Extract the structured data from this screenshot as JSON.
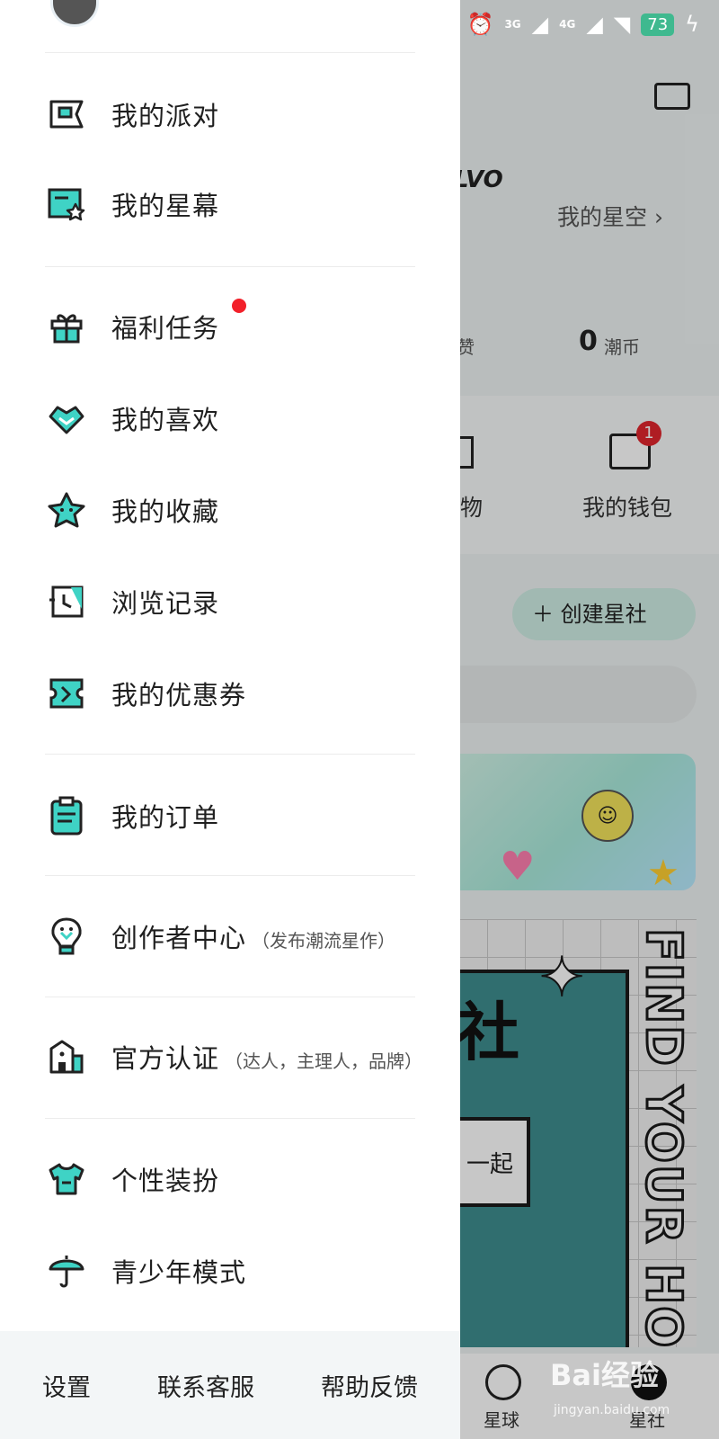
{
  "background_app": {
    "logo_text": "LVO",
    "star_sky_link": "我的星空",
    "likes_label": "赞",
    "coins_value": "0",
    "coins_label": "潮币",
    "item_partial_label": "物",
    "wallet_label": "我的钱包",
    "wallet_badge": "1",
    "create_club_button": "创建星社",
    "poster_title": "社",
    "poster_bubble_text": "一起",
    "poster_vertical_text": "FIND YOUR HO",
    "tab_planet": "星球",
    "tab_club": "星社"
  },
  "status_bar": {
    "network_3g": "3G",
    "network_4g": "4G",
    "battery_level": "73"
  },
  "drawer": {
    "menu": [
      {
        "label": "我的派对",
        "icon": "party-ticket-icon"
      },
      {
        "label": "我的星幕",
        "icon": "star-screen-icon"
      },
      {
        "label": "福利任务",
        "icon": "gift-icon",
        "has_badge": true
      },
      {
        "label": "我的喜欢",
        "icon": "heart-icon"
      },
      {
        "label": "我的收藏",
        "icon": "star-icon"
      },
      {
        "label": "浏览记录",
        "icon": "history-icon"
      },
      {
        "label": "我的优惠券",
        "icon": "coupon-icon"
      },
      {
        "label": "我的订单",
        "icon": "clipboard-icon"
      },
      {
        "label": "创作者中心",
        "sub": "（发布潮流星作）",
        "icon": "lightbulb-icon"
      },
      {
        "label": "官方认证",
        "sub": "（达人，主理人，品牌）",
        "icon": "building-icon"
      },
      {
        "label": "个性装扮",
        "icon": "tshirt-icon"
      },
      {
        "label": "青少年模式",
        "icon": "umbrella-icon"
      }
    ],
    "footer": {
      "settings": "设置",
      "contact_service": "联系客服",
      "help_feedback": "帮助反馈"
    }
  },
  "watermark": {
    "brand": "Bai经验",
    "url": "jingyan.baidu.com"
  },
  "colors": {
    "accent_teal": "#3fd3c5",
    "outline": "#222222",
    "badge_red": "#f2202a"
  }
}
